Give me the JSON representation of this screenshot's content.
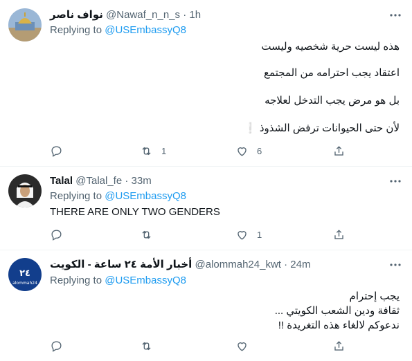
{
  "tweets": [
    {
      "name": "نواف ناصر",
      "handle": "@Nawaf_n_n_s",
      "dot": "·",
      "time": "1h",
      "reply_prefix": "Replying to ",
      "reply_to": "@USEmbassyQ8",
      "lines": [
        "هذه ليست حرية شخصيه وليست",
        "اعتقاد يجب احترامه من المجتمع",
        "بل هو مرض يجب التدخل لعلاجه",
        "لأن حتى الحيوانات ترفض الشذوذ ❕"
      ],
      "retweets": "1",
      "likes": "6"
    },
    {
      "name": "Talal",
      "handle": "@Talal_fe",
      "dot": "·",
      "time": "33m",
      "reply_prefix": "Replying to ",
      "reply_to": "@USEmbassyQ8",
      "lines": [
        "THERE ARE ONLY TWO GENDERS"
      ],
      "retweets": "",
      "likes": "1"
    },
    {
      "name": "أخبار الأمة ٢٤ ساعة - الكويت",
      "handle": "@alommah24_kwt",
      "dot": "·",
      "time": "24m",
      "reply_prefix": "Replying to ",
      "reply_to": "@USEmbassyQ8",
      "avatar_text": "alommah24",
      "lines": [
        "يجب إحترام",
        "ثقافة ودين الشعب الكويتي ...",
        "ندعوكم لالغاء هذه التغريدة !!"
      ],
      "retweets": "",
      "likes": ""
    }
  ],
  "colors": {
    "accent": "#1d9bf0",
    "muted": "#536471",
    "text": "#0f1419",
    "divider": "#eff3f4"
  },
  "icons": [
    "reply-icon",
    "retweet-icon",
    "like-icon",
    "share-icon",
    "more-icon"
  ]
}
